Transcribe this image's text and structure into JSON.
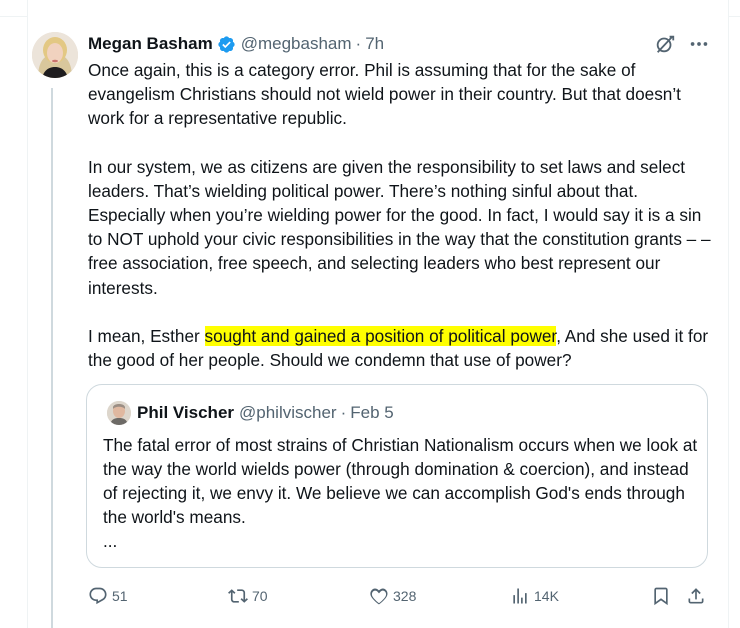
{
  "tweet": {
    "author_name": "Megan Basham",
    "author_handle": "@megbasham",
    "time_sep": "·",
    "time": "7h",
    "paragraphs": {
      "p1": "Once again, this is a category error. Phil is assuming that for the sake of evangelism Christians should not wield power in their country. But that doesn’t work for a representative republic.",
      "p2": "In our system, we as citizens are given the responsibility to set laws and select leaders. That’s wielding political power. There’s nothing sinful about that. Especially when you’re wielding power for the good. In fact, I would say it is a sin to NOT uphold your civic responsibilities  in the way that the constitution grants – – free association, free speech, and selecting leaders who best represent our interests.",
      "p3_before": "I mean, Esther ",
      "p3_highlight": "sought and gained a position of political power",
      "p3_after": ", And she used it for the good of her people. Should we condemn that use of power?"
    }
  },
  "quoted_tweet": {
    "author_name": "Phil Vischer",
    "author_handle": "@philvischer",
    "time_sep": "·",
    "time": "Feb 5",
    "text": "The fatal error of most strains of Christian Nationalism occurs when we look at the way the world wields power (through domination & coercion), and instead of rejecting it, we envy it.  We believe we can accomplish God's ends through the world's means.",
    "ellipsis": "..."
  },
  "actions": {
    "replies": "51",
    "reposts": "70",
    "likes": "328",
    "views": "14K"
  },
  "colors": {
    "highlight": "#ffff00",
    "verified": "#1d9bf0",
    "muted": "#536471",
    "text": "#0f1419"
  },
  "icons": [
    "verified-badge-icon",
    "grok-icon",
    "more-icon",
    "reply-icon",
    "repost-icon",
    "like-icon",
    "views-icon",
    "bookmark-icon",
    "share-icon"
  ]
}
